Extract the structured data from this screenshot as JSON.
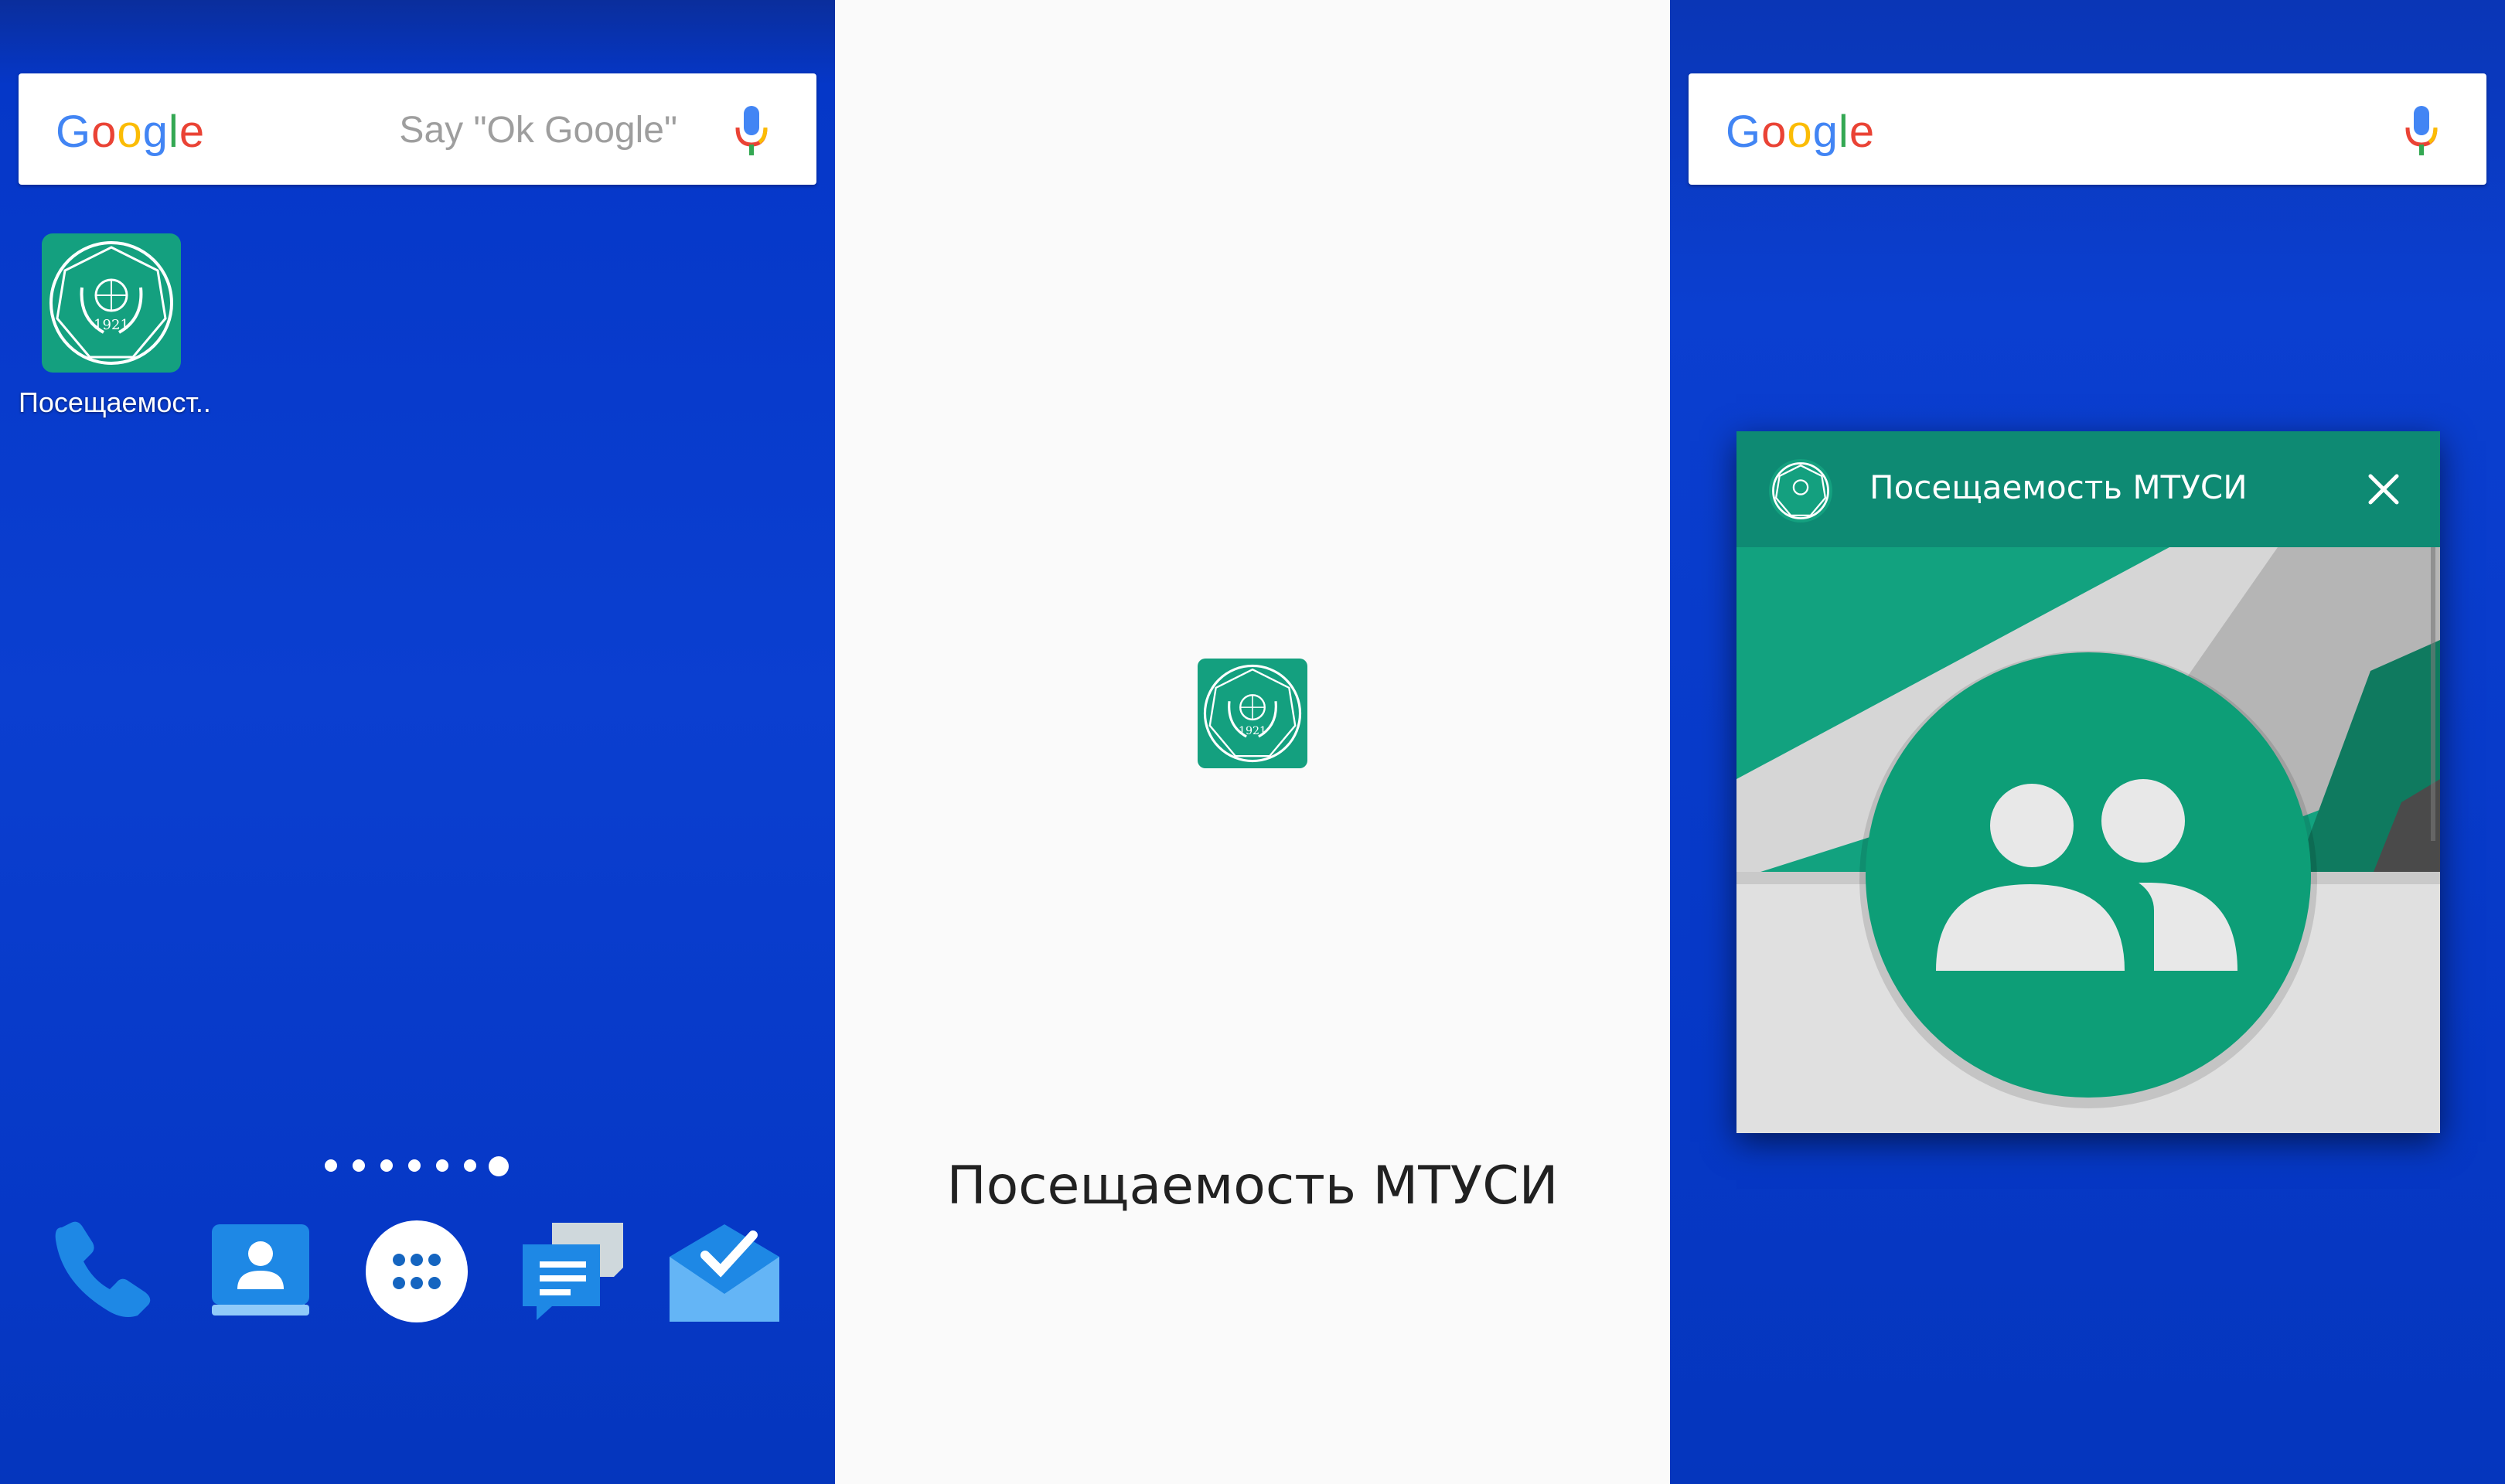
{
  "left_screen": {
    "search": {
      "logo_letters": [
        {
          "ch": "G",
          "color": "#4285F4"
        },
        {
          "ch": "o",
          "color": "#EA4335"
        },
        {
          "ch": "o",
          "color": "#FBBC05"
        },
        {
          "ch": "g",
          "color": "#4285F4"
        },
        {
          "ch": "l",
          "color": "#34A853"
        },
        {
          "ch": "e",
          "color": "#EA4335"
        }
      ],
      "hint": "Say \"Ok Google\""
    },
    "app": {
      "label": "Посещаемост..",
      "icon": "mtuci-logo-icon",
      "year": "1921"
    },
    "page_indicator": {
      "count": 7,
      "active_index": 6
    },
    "dock": [
      "phone-icon",
      "contacts-icon",
      "app-drawer-icon",
      "messages-icon",
      "inbox-icon"
    ]
  },
  "splash_screen": {
    "icon": "mtuci-logo-icon",
    "year": "1921",
    "title": "Посещаемость МТУСИ"
  },
  "right_screen": {
    "search": {
      "icon": "google-logo",
      "mic": "mic-icon"
    },
    "widget": {
      "title": "Посещаемость МТУСИ",
      "icon": "mtuci-logo-icon",
      "close": "close-icon",
      "illustration": "group-icon"
    }
  },
  "colors": {
    "wallpaper": "#0b3fd0",
    "brand_green": "#14a07f",
    "header_green": "#0e8a73",
    "splash_bg": "#fafafa"
  }
}
